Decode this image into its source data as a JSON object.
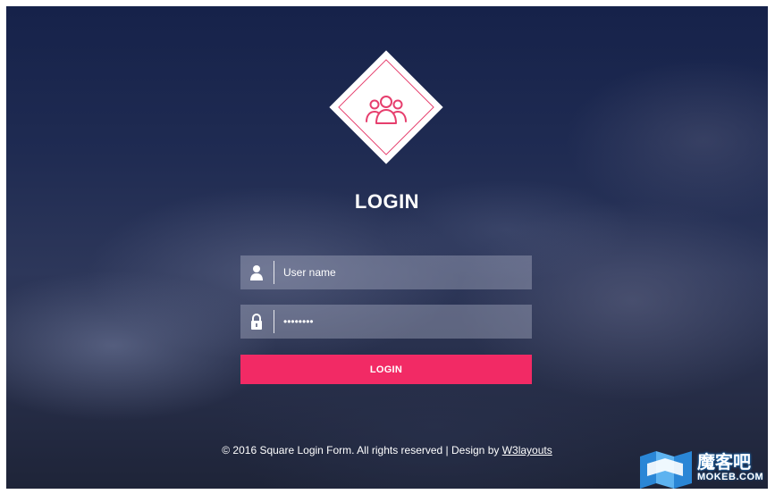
{
  "login": {
    "title": "LOGIN",
    "username": {
      "value": "",
      "placeholder": "User name"
    },
    "password": {
      "value": "password"
    },
    "submit_label": "LOGIN"
  },
  "footer": {
    "text": "© 2016 Square Login Form. All rights reserved | Design by ",
    "link_label": "W3layouts"
  },
  "watermark": {
    "title": "魔客吧",
    "subtitle": "MOKEB.COM"
  },
  "colors": {
    "accent": "#f22a65",
    "icon_outline": "#e63e6d"
  }
}
